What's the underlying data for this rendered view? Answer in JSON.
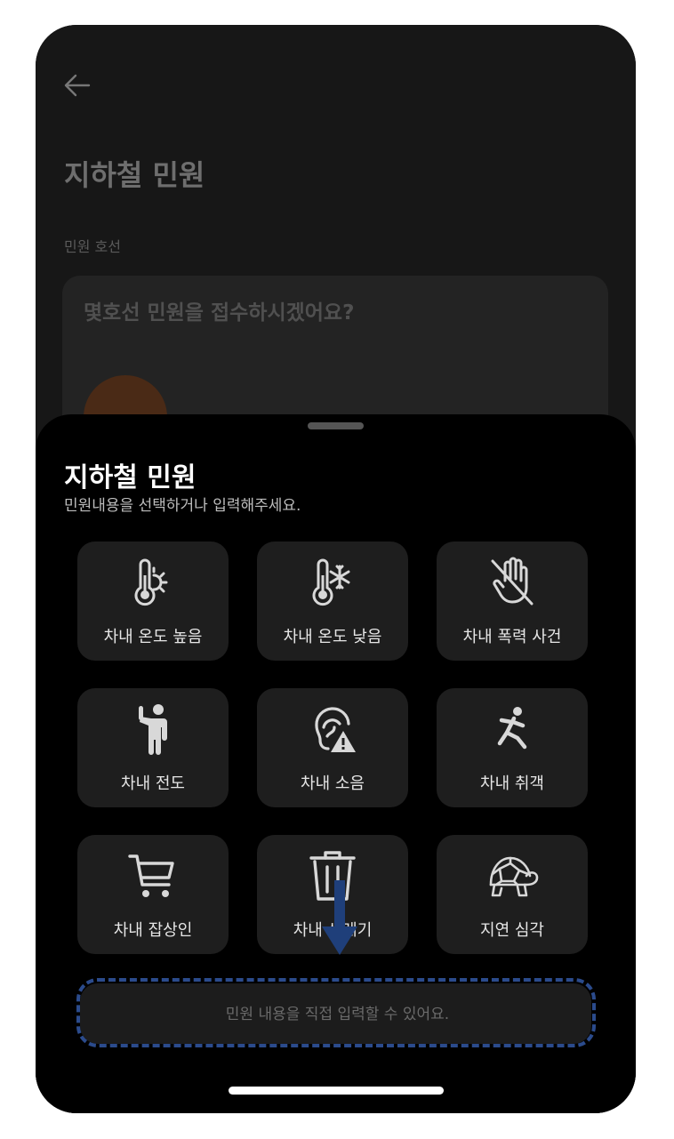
{
  "background": {
    "title": "지하철 민원",
    "line_label": "민원 호선",
    "question": "몇호선 민원을 접수하시겠어요?"
  },
  "sheet": {
    "title": "지하철 민원",
    "subtitle": "민원내용을 선택하거나 입력해주세요.",
    "options": [
      {
        "label": "차내 온도 높음",
        "icon": "thermometer-sun-icon"
      },
      {
        "label": "차내 온도 낮음",
        "icon": "thermometer-snow-icon"
      },
      {
        "label": "차내 폭력 사건",
        "icon": "hand-off-icon"
      },
      {
        "label": "차내 전도",
        "icon": "person-fall-icon"
      },
      {
        "label": "차내 소음",
        "icon": "ear-warning-icon"
      },
      {
        "label": "차내 취객",
        "icon": "person-slip-icon"
      },
      {
        "label": "차내 잡상인",
        "icon": "cart-icon"
      },
      {
        "label": "차내 쓰레기",
        "icon": "trash-icon"
      },
      {
        "label": "지연 심각",
        "icon": "turtle-icon"
      }
    ],
    "input_placeholder": "민원 내용을 직접 입력할 수 있어요."
  },
  "colors": {
    "hint_dash": "#2b4b8c",
    "hint_arrow": "#1f3f7a",
    "tile_bg": "#1e1e1e"
  }
}
